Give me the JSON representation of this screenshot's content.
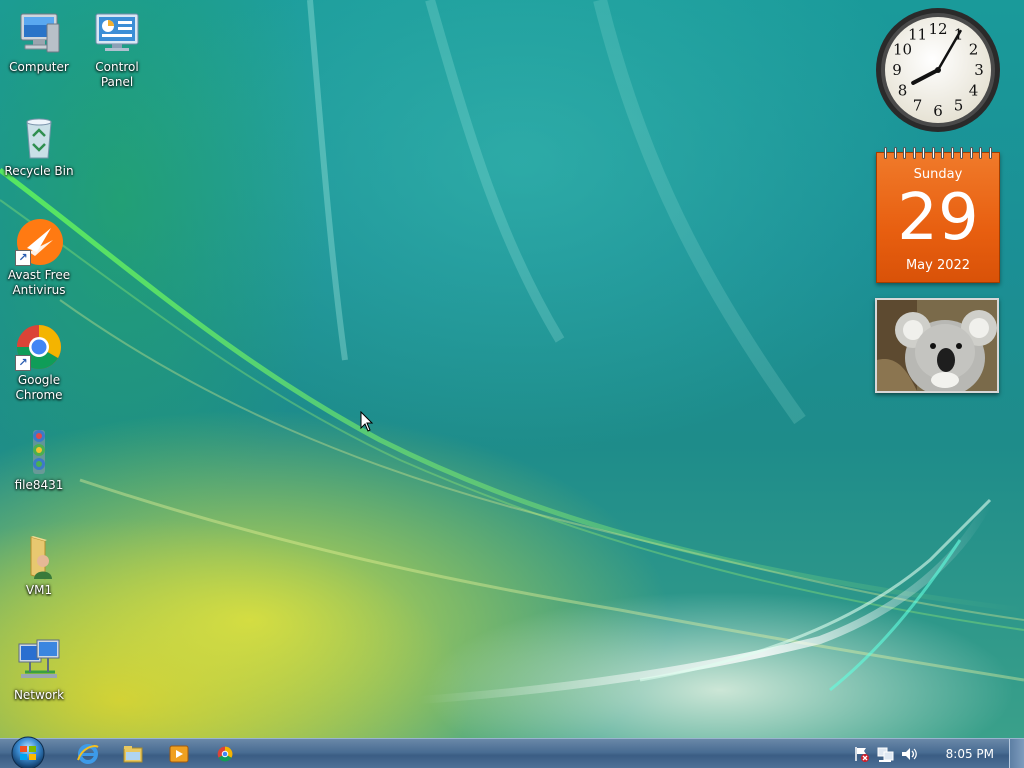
{
  "desktop_icons": [
    {
      "label": "Computer",
      "icon": "computer-icon"
    },
    {
      "label": "Control Panel",
      "icon": "control-panel-icon"
    },
    {
      "label": "Recycle Bin",
      "icon": "recycle-bin-icon"
    },
    {
      "label": "Avast Free Antivirus",
      "icon": "avast-icon"
    },
    {
      "label": "Google Chrome",
      "icon": "chrome-icon"
    },
    {
      "label": "file8431",
      "icon": "file-icon"
    },
    {
      "label": "VM1",
      "icon": "user-folder-icon"
    },
    {
      "label": "Network",
      "icon": "network-icon"
    }
  ],
  "gadgets": {
    "clock": {
      "hour": 8,
      "minute": 5,
      "numerals": [
        "12",
        "1",
        "2",
        "3",
        "4",
        "5",
        "6",
        "7",
        "8",
        "9",
        "10",
        "11"
      ]
    },
    "calendar": {
      "weekday": "Sunday",
      "day": "29",
      "month_year": "May 2022"
    },
    "slideshow": {
      "subject": "koala photo"
    }
  },
  "taskbar": {
    "start": "start-orb-icon",
    "pinned": [
      "internet-explorer-icon",
      "windows-explorer-icon",
      "media-player-icon",
      "chrome-icon"
    ],
    "tray_icons": [
      "action-center-flag-icon",
      "network-tray-icon",
      "volume-icon"
    ],
    "time": "8:05 PM"
  },
  "colors": {
    "calendar_orange": "#e85f10",
    "taskbar_blue": "#486c92"
  }
}
